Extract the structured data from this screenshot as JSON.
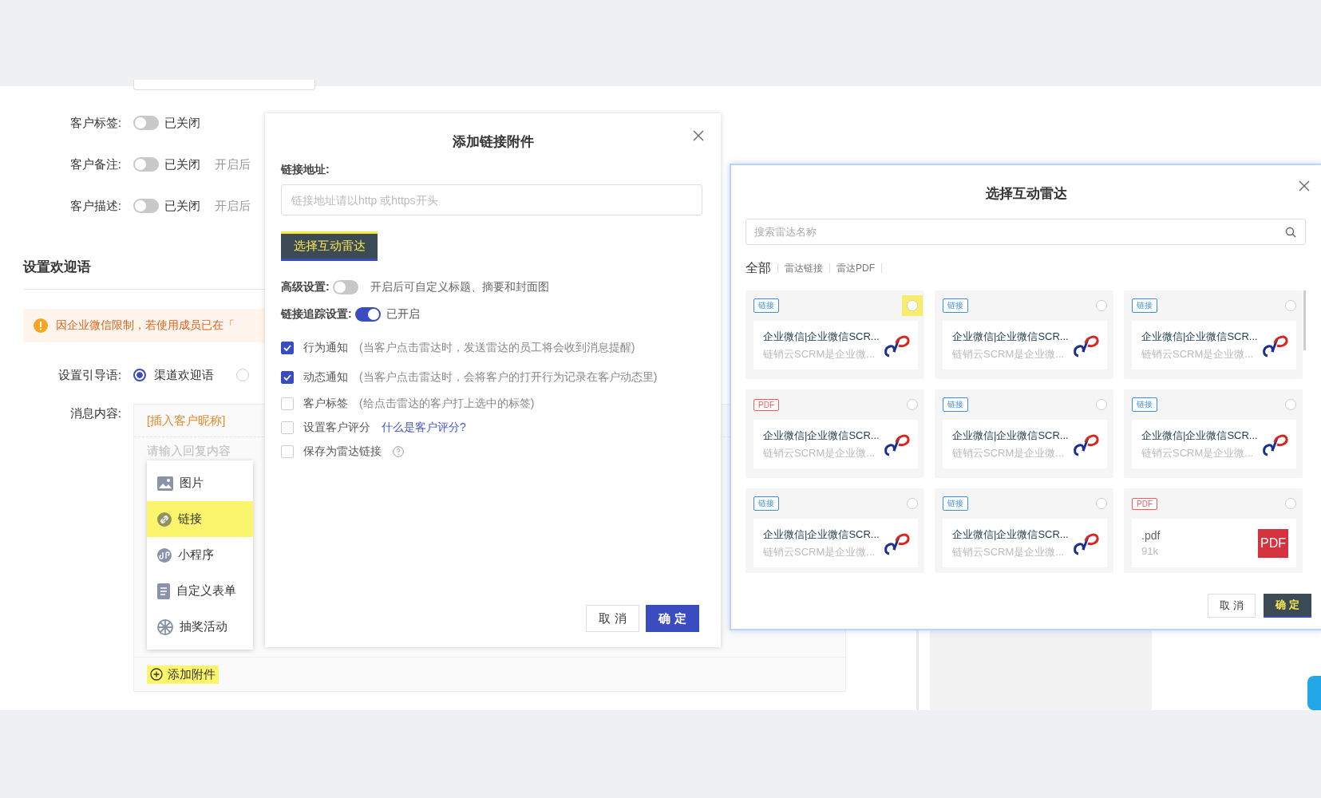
{
  "form": {
    "switch_rows": [
      {
        "label": "客户标签:",
        "on": false,
        "status": "已关闭"
      },
      {
        "label": "客户备注:",
        "on": false,
        "status": "已关闭",
        "hint": "开启后"
      },
      {
        "label": "客户描述:",
        "on": false,
        "status": "已关闭",
        "hint": "开启后"
      }
    ],
    "section_title": "设置欢迎语",
    "alert": "因企业微信限制，若使用成员已在「",
    "guide": {
      "label": "设置引导语:",
      "options": [
        {
          "label": "渠道欢迎语",
          "selected": true
        },
        {
          "selected": false
        }
      ]
    },
    "message": {
      "label": "消息内容:",
      "insert_tag": "[插入客户昵称]",
      "placeholder": "请输入回复内容",
      "menu": [
        {
          "kind": "image",
          "label": "图片",
          "highlighted": false
        },
        {
          "kind": "link",
          "label": "链接",
          "highlighted": true
        },
        {
          "kind": "miniapp",
          "label": "小程序",
          "highlighted": false
        },
        {
          "kind": "form",
          "label": "自定义表单",
          "highlighted": false
        },
        {
          "kind": "lottery",
          "label": "抽奖活动",
          "highlighted": false
        }
      ],
      "add_button": {
        "label": "添加附件",
        "highlighted": true
      }
    }
  },
  "link_dialog": {
    "title": "添加链接附件",
    "url_label": "链接地址:",
    "url_placeholder": "链接地址请以http 或https开头",
    "radar_button": {
      "label": "选择互动雷达",
      "highlighted": true
    },
    "advanced": {
      "label": "高级设置:",
      "on": false,
      "hint": "开启后可自定义标题、摘要和封面图"
    },
    "tracking": {
      "label": "链接追踪设置:",
      "on": true,
      "status": "已开启"
    },
    "options": [
      {
        "label": "行为通知",
        "checked": true,
        "note": "(当客户点击雷达时，发送雷达的员工将会收到消息提醒)"
      },
      {
        "label": "动态通知",
        "checked": true,
        "note": "(当客户点击雷达时，会将客户的打开行为记录在客户动态里)"
      },
      {
        "label": "客户标签",
        "checked": false,
        "note": "(给点击雷达的客户打上选中的标签)"
      },
      {
        "label": "设置客户评分",
        "checked": false,
        "link": "什么是客户评分?"
      },
      {
        "label": "保存为雷达链接",
        "checked": false,
        "help": true
      }
    ],
    "buttons": [
      {
        "kind": "cancel",
        "label": "取 消",
        "highlighted": false
      },
      {
        "kind": "ok",
        "label": "确 定",
        "highlighted": false
      }
    ]
  },
  "radar_dialog": {
    "title": "选择互动雷达",
    "search_placeholder": "搜索雷达名称",
    "tabs": [
      {
        "label": "全部",
        "selected": true
      },
      {
        "label": "雷达链接",
        "selected": false
      },
      {
        "label": "雷达PDF",
        "selected": false
      }
    ],
    "cards": [
      {
        "tag": "链接",
        "color": "#3a8ee6",
        "kind": "article",
        "title": "企业微信|企业微信SCR...",
        "desc": "链销云SCRM是企业微...",
        "selected": false,
        "highlighted": true
      },
      {
        "tag": "链接",
        "color": "#3a8ee6",
        "kind": "article",
        "title": "企业微信|企业微信SCR...",
        "desc": "链销云SCRM是企业微...",
        "selected": false,
        "highlighted": false
      },
      {
        "tag": "链接",
        "color": "#3a8ee6",
        "kind": "article",
        "title": "企业微信|企业微信SCR...",
        "desc": "链销云SCRM是企业微...",
        "selected": false,
        "highlighted": false
      },
      {
        "tag": "PDF",
        "color": "#f25b5b",
        "kind": "article",
        "title": "企业微信|企业微信SCR...",
        "desc": "链销云SCRM是企业微...",
        "selected": false,
        "highlighted": false
      },
      {
        "tag": "链接",
        "color": "#3a8ee6",
        "kind": "article",
        "title": "企业微信|企业微信SCR...",
        "desc": "链销云SCRM是企业微...",
        "selected": false,
        "highlighted": false
      },
      {
        "tag": "链接",
        "color": "#3a8ee6",
        "kind": "article",
        "title": "企业微信|企业微信SCR...",
        "desc": "链销云SCRM是企业微...",
        "selected": false,
        "highlighted": false
      },
      {
        "tag": "链接",
        "color": "#3a8ee6",
        "kind": "article",
        "title": "企业微信|企业微信SCR...",
        "desc": "链销云SCRM是企业微...",
        "selected": false,
        "highlighted": false
      },
      {
        "tag": "链接",
        "color": "#3a8ee6",
        "kind": "article",
        "title": "企业微信|企业微信SCR...",
        "desc": "链销云SCRM是企业微...",
        "selected": false,
        "highlighted": false
      },
      {
        "tag": "PDF",
        "color": "#f25b5b",
        "kind": "file",
        "title": ".pdf",
        "desc": "91k",
        "file_icon": "PDF",
        "selected": false,
        "highlighted": false
      }
    ],
    "buttons": [
      {
        "kind": "cancel",
        "label": "取 消",
        "highlighted": false
      },
      {
        "kind": "ok",
        "label": "确 定",
        "highlighted": true
      }
    ]
  }
}
